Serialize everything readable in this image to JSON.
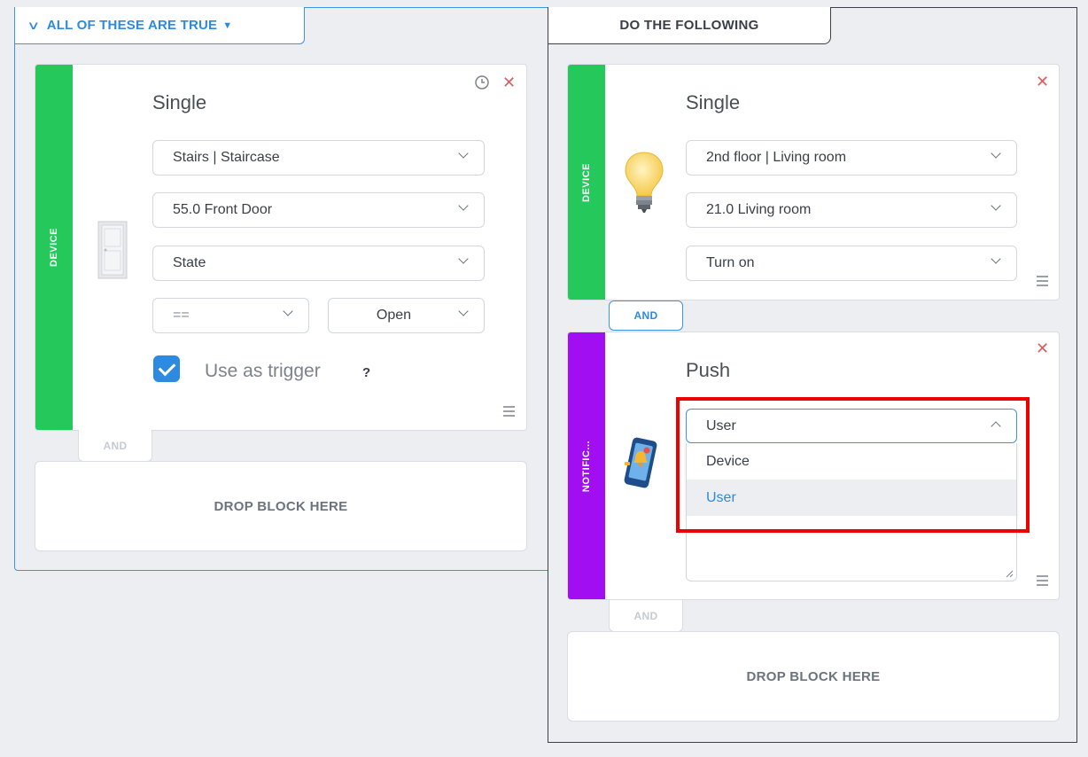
{
  "conditions": {
    "header_label": "ALL OF THESE ARE TRUE",
    "block": {
      "stripe_label": "DEVICE",
      "title": "Single",
      "room_select": "Stairs | Staircase",
      "device_select": "55.0 Front Door",
      "property_select": "State",
      "operator_select": "==",
      "value_select": "Open",
      "trigger_checked": true,
      "trigger_label": "Use as trigger",
      "trigger_help": "?"
    },
    "and_label": "AND",
    "drop_label": "DROP BLOCK HERE"
  },
  "actions": {
    "header_label": "DO THE FOLLOWING",
    "device_block": {
      "stripe_label": "DEVICE",
      "title": "Single",
      "room_select": "2nd floor | Living room",
      "device_select": "21.0 Living room",
      "action_select": "Turn on"
    },
    "and_label_active": "AND",
    "notification_block": {
      "stripe_label": "NOTIFIC...",
      "title": "Push",
      "target_select": "User",
      "options": [
        "Device",
        "User"
      ],
      "selected_option": "User"
    },
    "and_label": "AND",
    "drop_label": "DROP BLOCK HERE"
  },
  "colors": {
    "accent": "#2d8ae0",
    "device_stripe": "#25c95b",
    "notification_stripe": "#a10ef2",
    "close": "#e25c5c",
    "highlight": "#ee0000"
  }
}
